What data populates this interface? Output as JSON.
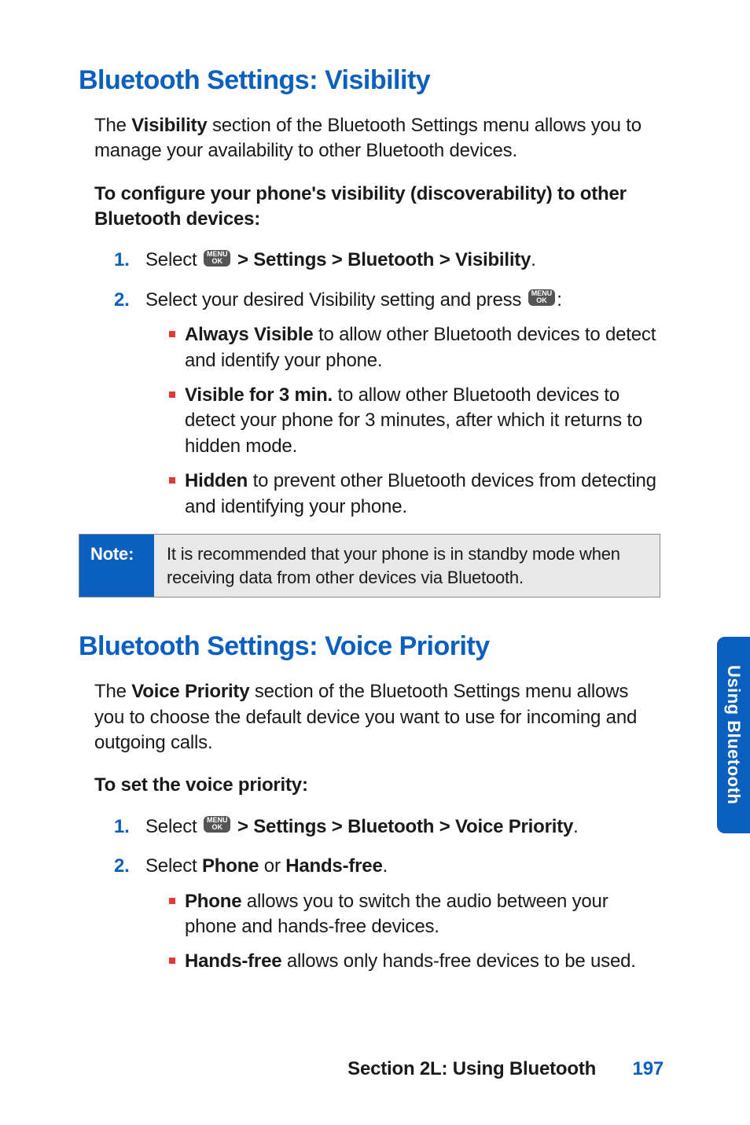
{
  "section1": {
    "title": "Bluetooth Settings: Visibility",
    "intro_pre": "The ",
    "intro_bold": "Visibility",
    "intro_post": " section of the Bluetooth Settings menu allows you to manage your availability to other Bluetooth devices.",
    "subhead": "To configure your phone's visibility (discoverability) to other Bluetooth devices:",
    "step1": {
      "num": "1.",
      "pre": "Select ",
      "bold": " > Settings > Bluetooth > Visibility",
      "post": "."
    },
    "step2": {
      "num": "2.",
      "pre": "Select your desired Visibility setting and press ",
      "post": ":"
    },
    "bullets": [
      {
        "bold": "Always Visible",
        "rest": " to allow other Bluetooth devices to detect and identify your phone."
      },
      {
        "bold": "Visible for 3 min.",
        "rest": " to allow other Bluetooth devices to detect your phone for 3 minutes, after which it returns to hidden mode."
      },
      {
        "bold": "Hidden",
        "rest": " to prevent other Bluetooth devices from detecting and identifying your phone."
      }
    ],
    "note_label": "Note:",
    "note_text": "It is recommended that your phone is in standby mode when receiving data from other devices via Bluetooth."
  },
  "section2": {
    "title": "Bluetooth Settings: Voice Priority",
    "intro_pre": "The ",
    "intro_bold": "Voice Priority",
    "intro_post": " section of the Bluetooth Settings menu allows you to choose the default device you want to use for incoming and outgoing calls.",
    "subhead": "To set the voice priority:",
    "step1": {
      "num": "1.",
      "pre": "Select ",
      "bold": " > Settings > Bluetooth > Voice Priority",
      "post": "."
    },
    "step2": {
      "num": "2.",
      "pre": "Select ",
      "bold1": "Phone",
      "mid": " or ",
      "bold2": "Hands-free",
      "post": "."
    },
    "bullets": [
      {
        "bold": "Phone",
        "rest": " allows you to switch the audio between your phone and hands-free devices."
      },
      {
        "bold": "Hands-free",
        "rest": " allows only hands-free devices to be used."
      }
    ]
  },
  "menukey": {
    "top": "MENU",
    "bot": "OK"
  },
  "sidetab": "Using Bluetooth",
  "footer": {
    "section": "Section 2L: Using Bluetooth",
    "page": "197"
  }
}
